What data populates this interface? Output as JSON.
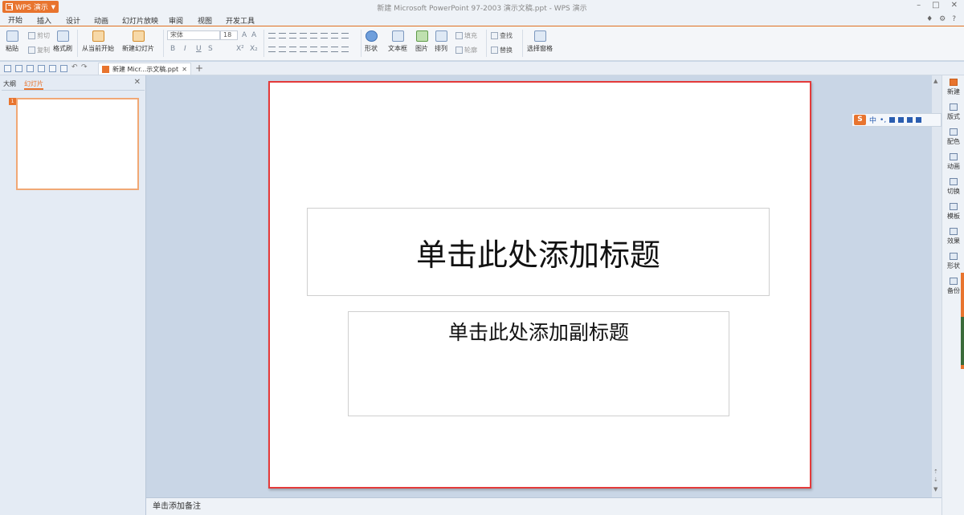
{
  "titlebar": {
    "app_name": "WPS 演示",
    "window_title": "新建 Microsoft PowerPoint 97-2003 演示文稿.ppt - WPS 演示"
  },
  "menu": {
    "tabs": [
      "开始",
      "插入",
      "设计",
      "动画",
      "幻灯片放映",
      "审阅",
      "视图",
      "开发工具"
    ],
    "active_index": 0
  },
  "ribbon": {
    "paste": "粘贴",
    "cut": "剪切",
    "copy": "复制",
    "format_painter": "格式刷",
    "from_current": "从当前开始",
    "new_slide": "新建幻灯片",
    "font_name": "宋体",
    "font_size": "18",
    "bold": "B",
    "italic": "I",
    "underline": "U",
    "strike": "S",
    "superscript": "X²",
    "subscript": "X₂",
    "shape": "形状",
    "textbox": "文本框",
    "picture": "图片",
    "arrange": "排列",
    "fill": "填充",
    "outline": "轮廓",
    "find": "查找",
    "replace": "替换",
    "select_pane": "选择窗格"
  },
  "doc_tab": {
    "label": "新建 Micr...示文稿.ppt"
  },
  "left_panel": {
    "tab_outline": "大纲",
    "tab_slides": "幻灯片",
    "slide_number": "1"
  },
  "slide": {
    "title_placeholder": "单击此处添加标题",
    "subtitle_placeholder": "单击此处添加副标题"
  },
  "side_panel": {
    "items": [
      "新建",
      "版式",
      "配色",
      "动画",
      "切换",
      "模板",
      "效果",
      "形状",
      "备份"
    ]
  },
  "ime": {
    "mode": "中"
  },
  "notes": {
    "placeholder": "单击添加备注"
  }
}
